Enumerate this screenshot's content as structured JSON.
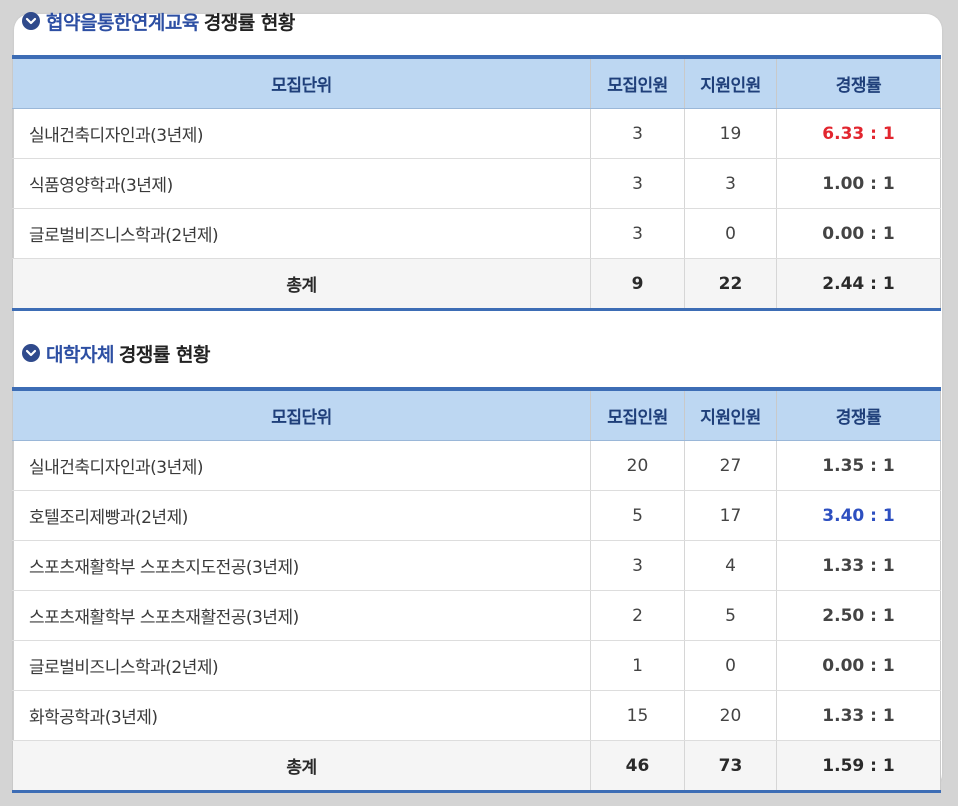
{
  "sections": [
    {
      "title_highlight": "협약을통한연계교육",
      "title_rest": "경쟁률 현황",
      "headers": [
        "모집단위",
        "모집인원",
        "지원인원",
        "경쟁률"
      ],
      "rows": [
        {
          "unit": "실내건축디자인과(3년제)",
          "quota": "3",
          "applicants": "19",
          "ratio": "6.33 : 1",
          "ratio_color": "#e2262f"
        },
        {
          "unit": "식품영양학과(3년제)",
          "quota": "3",
          "applicants": "3",
          "ratio": "1.00 : 1",
          "ratio_color": "#444444"
        },
        {
          "unit": "글로벌비즈니스학과(2년제)",
          "quota": "3",
          "applicants": "0",
          "ratio": "0.00 : 1",
          "ratio_color": "#444444"
        }
      ],
      "total": {
        "label": "총계",
        "quota": "9",
        "applicants": "22",
        "ratio": "2.44 : 1"
      }
    },
    {
      "title_highlight": "대학자체",
      "title_rest": "경쟁률 현황",
      "headers": [
        "모집단위",
        "모집인원",
        "지원인원",
        "경쟁률"
      ],
      "rows": [
        {
          "unit": "실내건축디자인과(3년제)",
          "quota": "20",
          "applicants": "27",
          "ratio": "1.35 : 1",
          "ratio_color": "#444444"
        },
        {
          "unit": "호텔조리제빵과(2년제)",
          "quota": "5",
          "applicants": "17",
          "ratio": "3.40 : 1",
          "ratio_color": "#2d4fc0"
        },
        {
          "unit": "스포츠재활학부 스포츠지도전공(3년제)",
          "quota": "3",
          "applicants": "4",
          "ratio": "1.33 : 1",
          "ratio_color": "#444444"
        },
        {
          "unit": "스포츠재활학부 스포츠재활전공(3년제)",
          "quota": "2",
          "applicants": "5",
          "ratio": "2.50 : 1",
          "ratio_color": "#444444"
        },
        {
          "unit": "글로벌비즈니스학과(2년제)",
          "quota": "1",
          "applicants": "0",
          "ratio": "0.00 : 1",
          "ratio_color": "#444444"
        },
        {
          "unit": "화학공학과(3년제)",
          "quota": "15",
          "applicants": "20",
          "ratio": "1.33 : 1",
          "ratio_color": "#444444"
        }
      ],
      "total": {
        "label": "총계",
        "quota": "46",
        "applicants": "73",
        "ratio": "1.59 : 1"
      }
    }
  ],
  "icons": {
    "section_bullet": "chevron-down-circle-icon"
  }
}
